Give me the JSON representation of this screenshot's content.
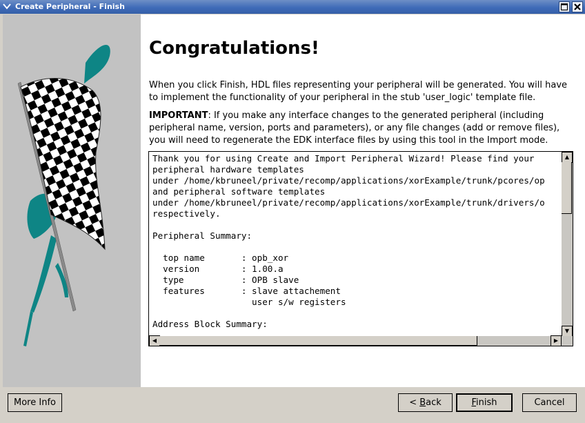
{
  "window": {
    "title": "Create Peripheral - Finish",
    "menu_icon": "chevron-down-icon",
    "maximize_icon": "maximize-icon",
    "close_icon": "close-icon"
  },
  "main": {
    "heading": "Congratulations!",
    "intro": "When you click Finish, HDL files representing your peripheral will be generated. You will have to implement the functionality of your peripheral in the stub 'user_logic' template file.",
    "important_label": "IMPORTANT",
    "important_text": ": If you make any interface changes to the generated peripheral (including peripheral name, version, ports and parameters), or any file changes (add or remove files), you will need to regenerate the EDK interface files by using this tool in the Import mode.",
    "summary_lines": [
      "Thank you for using Create and Import Peripheral Wizard! Please find your",
      "peripheral hardware templates",
      "under /home/kbruneel/private/recomp/applications/xorExample/trunk/pcores/op",
      "and peripheral software templates",
      "under /home/kbruneel/private/recomp/applications/xorExample/trunk/drivers/o",
      "respectively.",
      "",
      "Peripheral Summary:",
      "",
      "  top name       : opb_xor",
      "  version        : 1.00.a",
      "  type           : OPB slave",
      "  features       : slave attachement",
      "                   user s/w registers",
      "",
      "Address Block Summary:"
    ]
  },
  "buttons": {
    "more_info": "More Info",
    "back_prefix": "< ",
    "back_key": "B",
    "back_rest": "ack",
    "finish_key": "F",
    "finish_rest": "inish",
    "cancel": "Cancel"
  }
}
